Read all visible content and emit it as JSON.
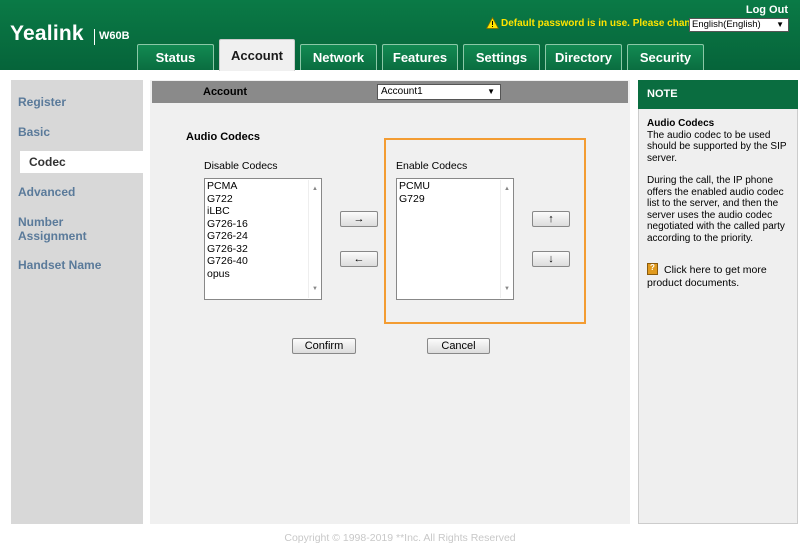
{
  "header": {
    "brand": "Yealink",
    "model": "W60B",
    "logout_label": "Log Out",
    "warning_text": "Default password is in use. Please change!",
    "language_selected": "English(English)"
  },
  "tabs": [
    {
      "label": "Status"
    },
    {
      "label": "Account"
    },
    {
      "label": "Network"
    },
    {
      "label": "Features"
    },
    {
      "label": "Settings"
    },
    {
      "label": "Directory"
    },
    {
      "label": "Security"
    }
  ],
  "sidebar": {
    "items": [
      {
        "label": "Register"
      },
      {
        "label": "Basic"
      },
      {
        "label": "Codec"
      },
      {
        "label": "Advanced"
      },
      {
        "label": "Number Assignment"
      },
      {
        "label": "Handset Name"
      }
    ],
    "active": "Codec"
  },
  "account_bar": {
    "label": "Account",
    "selected": "Account1"
  },
  "codecs": {
    "section_title": "Audio Codecs",
    "disable_title": "Disable Codecs",
    "enable_title": "Enable Codecs",
    "disabled": [
      "PCMA",
      "G722",
      "iLBC",
      "G726-16",
      "G726-24",
      "G726-32",
      "G726-40",
      "opus"
    ],
    "enabled": [
      "PCMU",
      "G729"
    ],
    "move_right": "→",
    "move_left": "←",
    "move_up": "↑",
    "move_down": "↓",
    "confirm_label": "Confirm",
    "cancel_label": "Cancel"
  },
  "note": {
    "header": "NOTE",
    "title": "Audio Codecs",
    "para1": "The audio codec to be used should be supported by the SIP server.",
    "para2": "During the call, the IP phone offers the enabled audio codec list to the server, and then the server uses the audio codec negotiated with the called party according to the priority.",
    "link": "Click here to get more product documents."
  },
  "footer": {
    "copyright": "Copyright © 1998-2019 **Inc. All Rights Reserved"
  },
  "colors": {
    "header_green": "#0a7a46",
    "warning_yellow": "#ffe400",
    "highlight_orange": "#f39c32",
    "sidebar_link": "#5a7a9a"
  }
}
